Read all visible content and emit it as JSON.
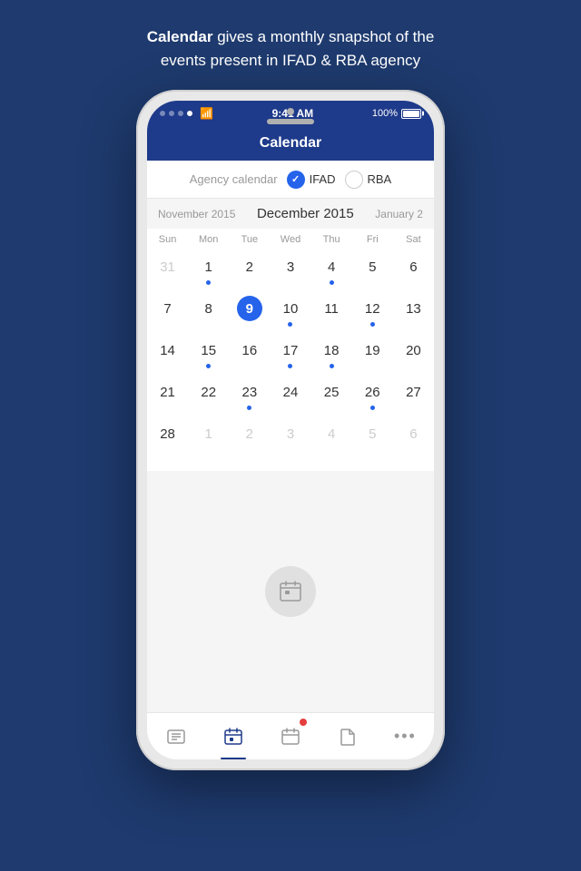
{
  "header": {
    "line1_bold": "Calendar",
    "line1_rest": " gives a monthly snapshot of the",
    "line2": "events present in IFAD & RBA agency"
  },
  "status_bar": {
    "time": "9:41 AM",
    "battery_pct": "100%"
  },
  "nav": {
    "title": "Calendar"
  },
  "agency_filter": {
    "label": "Agency calendar",
    "option1": "IFAD",
    "option2": "RBA"
  },
  "calendar": {
    "prev_month": "November 2015",
    "current_month": "December 2015",
    "next_month": "January 2",
    "day_headers": [
      "Sun",
      "Mon",
      "Tue",
      "Wed",
      "Thu",
      "Fri",
      "Sat"
    ],
    "weeks": [
      [
        {
          "num": "31",
          "other": true,
          "dot": false
        },
        {
          "num": "1",
          "other": false,
          "dot": true
        },
        {
          "num": "2",
          "other": false,
          "dot": false
        },
        {
          "num": "3",
          "other": false,
          "dot": false
        },
        {
          "num": "4",
          "other": false,
          "dot": true
        },
        {
          "num": "5",
          "other": false,
          "dot": false
        },
        {
          "num": "6",
          "other": false,
          "dot": false
        }
      ],
      [
        {
          "num": "7",
          "other": false,
          "dot": false
        },
        {
          "num": "8",
          "other": false,
          "dot": false
        },
        {
          "num": "9",
          "other": false,
          "dot": false,
          "today": true
        },
        {
          "num": "10",
          "other": false,
          "dot": true
        },
        {
          "num": "11",
          "other": false,
          "dot": false
        },
        {
          "num": "12",
          "other": false,
          "dot": true
        },
        {
          "num": "13",
          "other": false,
          "dot": false
        }
      ],
      [
        {
          "num": "14",
          "other": false,
          "dot": false
        },
        {
          "num": "15",
          "other": false,
          "dot": true
        },
        {
          "num": "16",
          "other": false,
          "dot": false
        },
        {
          "num": "17",
          "other": false,
          "dot": true
        },
        {
          "num": "18",
          "other": false,
          "dot": true
        },
        {
          "num": "19",
          "other": false,
          "dot": false
        },
        {
          "num": "20",
          "other": false,
          "dot": false
        }
      ],
      [
        {
          "num": "21",
          "other": false,
          "dot": false
        },
        {
          "num": "22",
          "other": false,
          "dot": false
        },
        {
          "num": "23",
          "other": false,
          "dot": true
        },
        {
          "num": "24",
          "other": false,
          "dot": false
        },
        {
          "num": "25",
          "other": false,
          "dot": false
        },
        {
          "num": "26",
          "other": false,
          "dot": true
        },
        {
          "num": "27",
          "other": false,
          "dot": false
        }
      ],
      [
        {
          "num": "28",
          "other": false,
          "dot": false
        },
        {
          "num": "1",
          "other": true,
          "dot": false
        },
        {
          "num": "2",
          "other": true,
          "dot": false
        },
        {
          "num": "3",
          "other": true,
          "dot": false
        },
        {
          "num": "4",
          "other": true,
          "dot": false
        },
        {
          "num": "5",
          "other": true,
          "dot": false
        },
        {
          "num": "6",
          "other": true,
          "dot": false
        }
      ]
    ]
  },
  "tabs": [
    {
      "icon": "list",
      "active": false,
      "badge": false
    },
    {
      "icon": "calendar-small",
      "active": true,
      "badge": false
    },
    {
      "icon": "calendar-badge",
      "active": false,
      "badge": true
    },
    {
      "icon": "doc",
      "active": false,
      "badge": false
    },
    {
      "icon": "dots",
      "active": false,
      "badge": false
    }
  ]
}
